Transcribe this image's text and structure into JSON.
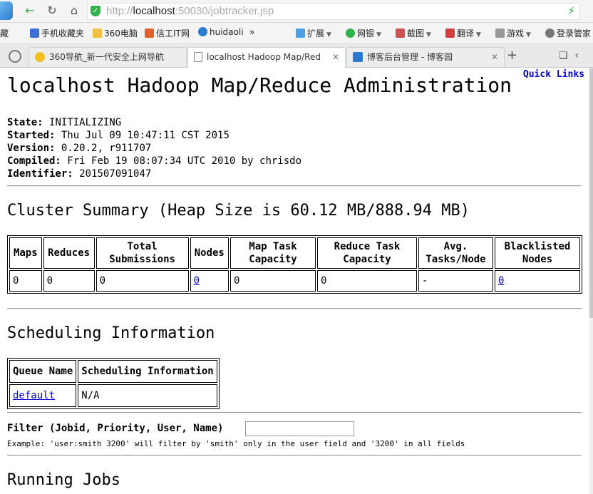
{
  "browser": {
    "url_scheme": "http://",
    "url_host": "localhost",
    "url_rest": ":50030/jobtracker.jsp",
    "bookmarks": [
      {
        "label": "藏",
        "color": ""
      },
      {
        "label": "手机收藏夹",
        "color": "#3a6fd8"
      },
      {
        "label": "360电脑",
        "color": "#f0c040"
      },
      {
        "label": "信工IT网",
        "color": "#e06030"
      },
      {
        "label": "huidaoli",
        "color": "#2a7bd0"
      },
      {
        "label": "»",
        "color": ""
      },
      {
        "label": "扩展",
        "color": "#4aa0e0"
      },
      {
        "label": "网银",
        "color": "#2fb24a"
      },
      {
        "label": "截图",
        "color": "#d05050"
      },
      {
        "label": "翻译",
        "color": "#d04040"
      },
      {
        "label": "游戏",
        "color": "#999999"
      },
      {
        "label": "登录管家",
        "color": "#777777"
      }
    ],
    "tabs": [
      {
        "label": "360导航_新一代安全上网导航",
        "active": false
      },
      {
        "label": "localhost Hadoop Map/Red",
        "active": true
      },
      {
        "label": "博客后台管理 - 博客园",
        "active": false
      }
    ]
  },
  "page": {
    "quick_links": "Quick Links",
    "title": "localhost Hadoop Map/Reduce Administration",
    "info": {
      "state_label": "State:",
      "state": "INITIALIZING",
      "started_label": "Started:",
      "started": "Thu Jul 09 10:47:11 CST 2015",
      "version_label": "Version:",
      "version": "0.20.2, r911707",
      "compiled_label": "Compiled:",
      "compiled": "Fri Feb 19 08:07:34 UTC 2010 by chrisdo",
      "identifier_label": "Identifier:",
      "identifier": "201507091047"
    },
    "cluster_summary": {
      "heading": "Cluster Summary (Heap Size is 60.12 MB/888.94 MB)",
      "headers": [
        "Maps",
        "Reduces",
        "Total Submissions",
        "Nodes",
        "Map Task Capacity",
        "Reduce Task Capacity",
        "Avg. Tasks/Node",
        "Blacklisted Nodes"
      ],
      "row": [
        "0",
        "0",
        "0",
        "0",
        "0",
        "0",
        "-",
        "0"
      ]
    },
    "scheduling": {
      "heading": "Scheduling Information",
      "headers": [
        "Queue Name",
        "Scheduling Information"
      ],
      "row": [
        "default",
        "N/A"
      ]
    },
    "filter": {
      "label": "Filter (Jobid, Priority, User, Name)",
      "value": "",
      "example": "Example: 'user:smith 3200' will filter by 'smith' only in the user field and '3200' in all fields"
    },
    "running_jobs_heading": "Running Jobs"
  }
}
